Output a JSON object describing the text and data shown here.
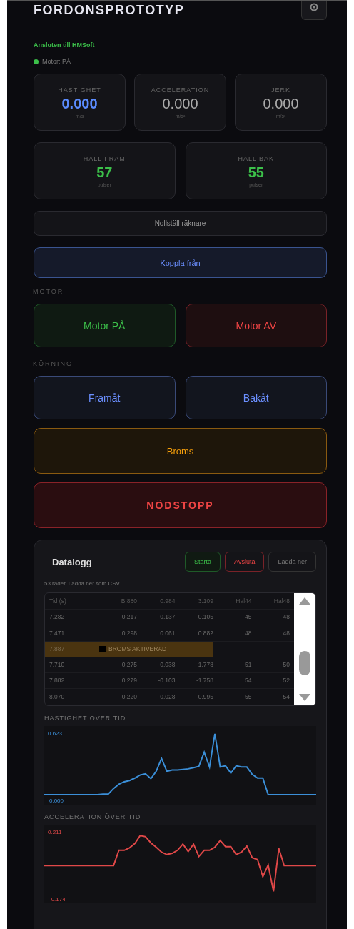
{
  "header": {
    "title": "FORDONSPROTOTYP"
  },
  "status": {
    "connection": "Ansluten till HMSoft",
    "motor_text": "Motor: PÅ",
    "motor_on": true
  },
  "stats": [
    {
      "label": "HASTIGHET",
      "value": "0.000",
      "unit": "m/s",
      "kind": "speed"
    },
    {
      "label": "ACCELERATION",
      "value": "0.000",
      "unit": "m/s²",
      "kind": "plain"
    },
    {
      "label": "JERK",
      "value": "0.000",
      "unit": "m/s³",
      "kind": "plain"
    }
  ],
  "hall": [
    {
      "label": "HALL FRAM",
      "value": "57",
      "unit": "pulser"
    },
    {
      "label": "HALL BAK",
      "value": "55",
      "unit": "pulser"
    }
  ],
  "reset_button": "Nollställ räknare",
  "disconnect_button": "Koppla från",
  "motor_section": {
    "label": "MOTOR",
    "buttons": [
      {
        "label": "Motor PÅ",
        "kind": "green"
      },
      {
        "label": "Motor AV",
        "kind": "red"
      }
    ]
  },
  "drive_section": {
    "label": "KÖRNING",
    "buttons": [
      {
        "label": "Framåt",
        "kind": "blue"
      },
      {
        "label": "Bakåt",
        "kind": "blue"
      }
    ]
  },
  "brake_button": "Broms",
  "emergency_button": "NÖDSTOPP",
  "datalog": {
    "title": "Datalogg",
    "buttons": [
      {
        "label": "Starta",
        "kind": "green"
      },
      {
        "label": "Avsluta",
        "kind": "red"
      },
      {
        "label": "Ladda ner",
        "kind": "plain"
      }
    ],
    "note": "53 rader. Ladda ner som CSV.",
    "columns": [
      "Tid (s)",
      "B.880",
      "0.984",
      "3.109",
      "Hal44",
      "Hal48"
    ],
    "rows": [
      {
        "kind": "data",
        "cells": [
          "7.282",
          "0.217",
          "0.137",
          "0.105",
          "45",
          "48"
        ]
      },
      {
        "kind": "data",
        "cells": [
          "7.471",
          "0.298",
          "0.061",
          "0.882",
          "48",
          "48"
        ]
      },
      {
        "kind": "event",
        "time": "7.887",
        "event": "BROMS AKTIVERAD"
      },
      {
        "kind": "data",
        "cells": [
          "7.710",
          "0.275",
          "0.038",
          "-1.778",
          "51",
          "50"
        ]
      },
      {
        "kind": "data",
        "cells": [
          "7.882",
          "0.279",
          "-0.103",
          "-1.758",
          "54",
          "52"
        ]
      },
      {
        "kind": "data",
        "cells": [
          "8.070",
          "0.220",
          "0.028",
          "0.995",
          "55",
          "54"
        ]
      }
    ],
    "charts": [
      {
        "title": "HASTIGHET ÖVER TID",
        "max_label": "0.623",
        "min_label": "0.000",
        "kind": "speed"
      },
      {
        "title": "ACCELERATION ÖVER TID",
        "max_label": "0.211",
        "min_label": "-0.174",
        "kind": "accel"
      }
    ]
  }
}
